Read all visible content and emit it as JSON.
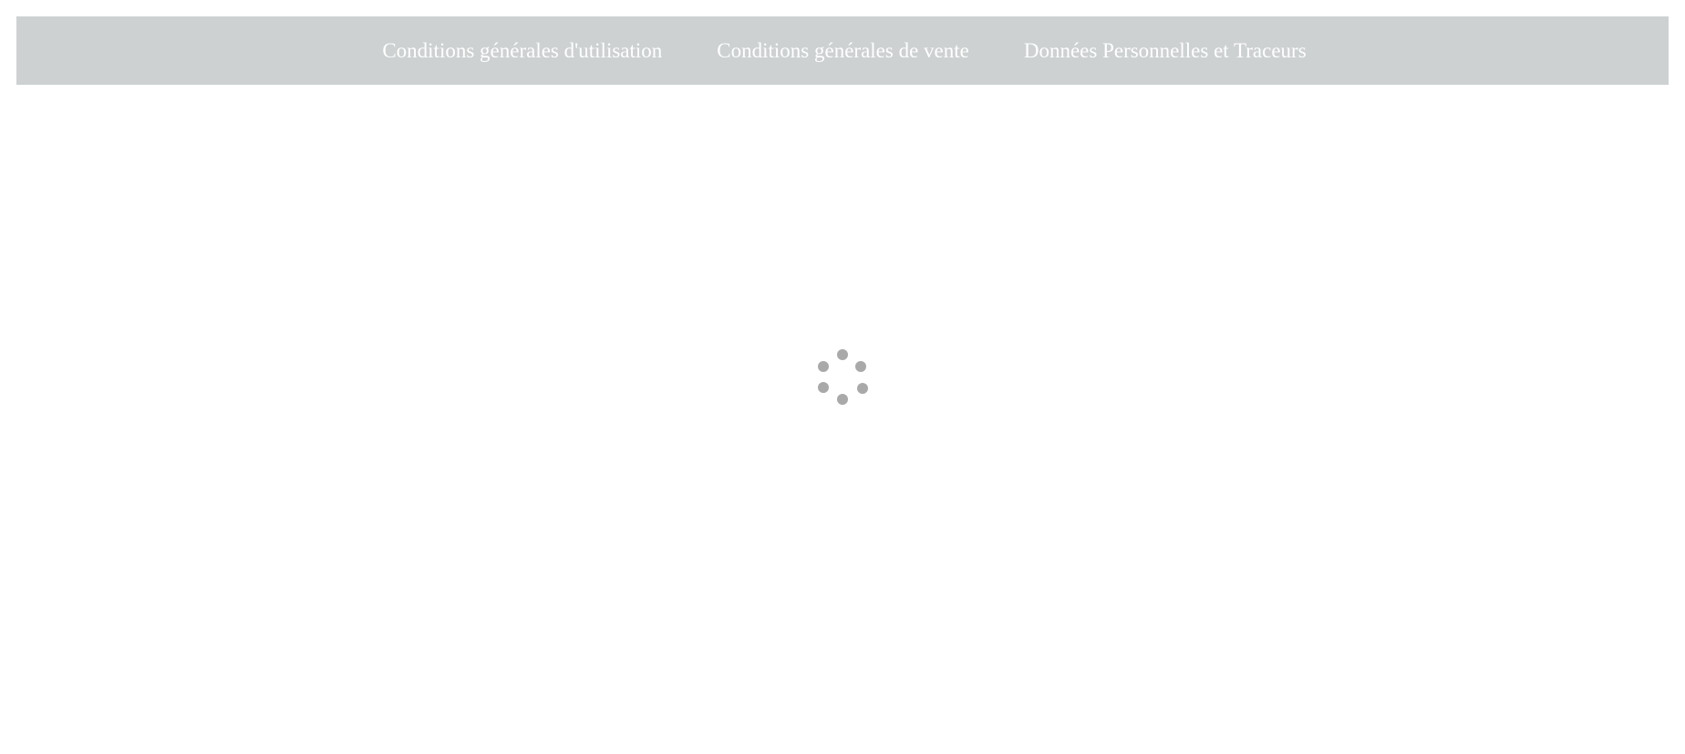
{
  "nav": {
    "links": [
      {
        "label": "Conditions générales d'utilisation"
      },
      {
        "label": "Conditions générales de vente"
      },
      {
        "label": "Données Personnelles et Traceurs"
      }
    ]
  },
  "loader": {
    "icon": "loading-spinner-icon",
    "color": "#a9a9a9"
  },
  "colors": {
    "nav_background": "#cdd1d2",
    "nav_text": "#ffffff",
    "page_background": "#ffffff"
  }
}
